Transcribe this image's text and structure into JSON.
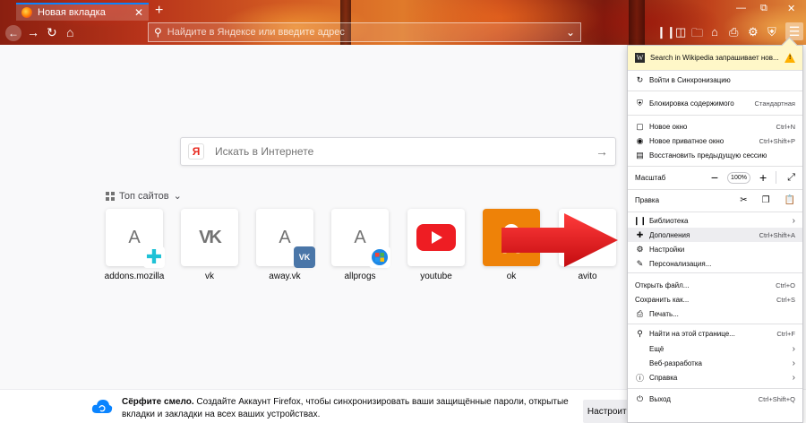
{
  "tab": {
    "title": "Новая вкладка",
    "close": "✕",
    "new": "+"
  },
  "window_controls": {
    "minimize": "—",
    "restore": "⧉",
    "close": "✕"
  },
  "urlbar": {
    "placeholder": "Найдите в Яндексе или введите адрес"
  },
  "newtab": {
    "search_placeholder": "Искать в Интернете",
    "ya_logo": "Я",
    "topsites_label": "Топ сайтов",
    "tiles": [
      {
        "label": "addons.mozilla",
        "letter": "A"
      },
      {
        "label": "vk",
        "letter": "VK"
      },
      {
        "label": "away.vk",
        "letter": "A"
      },
      {
        "label": "allprogs",
        "letter": "A"
      },
      {
        "label": "youtube",
        "letter": ""
      },
      {
        "label": "ok",
        "letter": ""
      },
      {
        "label": "avito",
        "letter": ""
      }
    ]
  },
  "sync_bar": {
    "bold": "Сёрфите смело.",
    "text": " Создайте Аккаунт Firefox, чтобы синхронизировать ваши защищённые пароли, открытые вкладки и закладки на всех ваших устройствах.",
    "button": "Настроить Синхронизацию"
  },
  "menu": {
    "wiki_notice": "Search in Wikipedia запрашивает нов...",
    "sync": "Войти в Синхронизацию",
    "blocking": "Блокировка содержимого",
    "blocking_value": "Стандартная",
    "new_window": "Новое окно",
    "new_window_short": "Ctrl+N",
    "private_window": "Новое приватное окно",
    "private_window_short": "Ctrl+Shift+P",
    "restore_session": "Восстановить предыдущую сессию",
    "zoom_label": "Масштаб",
    "zoom_value": "100%",
    "edit_label": "Правка",
    "library": "Библиотека",
    "addons": "Дополнения",
    "addons_short": "Ctrl+Shift+A",
    "settings": "Настройки",
    "customize": "Персонализация...",
    "open_file": "Открыть файл...",
    "open_file_short": "Ctrl+O",
    "save_as": "Сохранить как...",
    "save_as_short": "Ctrl+S",
    "print": "Печать...",
    "find": "Найти на этой странице...",
    "find_short": "Ctrl+F",
    "more": "Ещё",
    "webdev": "Веб-разработка",
    "help": "Справка",
    "quit": "Выход",
    "quit_short": "Ctrl+Shift+Q"
  },
  "colors": {
    "accent": "#0a84ff",
    "arrow": "#e8141a",
    "vk": "#4a76a8",
    "ok": "#ee8208",
    "youtube": "#ee1d23"
  }
}
